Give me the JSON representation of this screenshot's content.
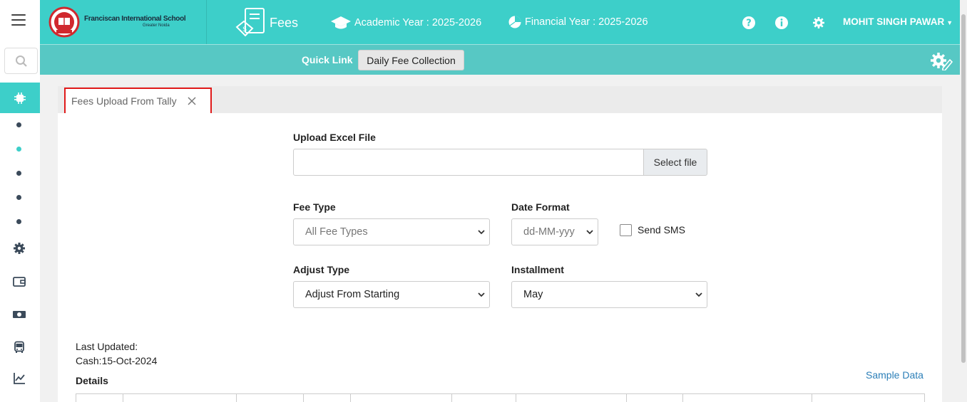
{
  "school": {
    "name": "Franciscan International School",
    "subtitle": "Greater Noida"
  },
  "module": {
    "title": "Fees"
  },
  "topbar": {
    "academic_year": "Academic Year : 2025-2026",
    "financial_year": "Financial Year : 2025-2026",
    "user": "MOHIT SINGH PAWAR"
  },
  "quicklink": {
    "label": "Quick Link",
    "button": "Daily Fee Collection"
  },
  "tab": {
    "label": "Fees Upload From Tally"
  },
  "form": {
    "upload_label": "Upload Excel File",
    "select_file": "Select file",
    "fee_type_label": "Fee Type",
    "fee_type_value": "All Fee Types",
    "date_format_label": "Date Format",
    "date_format_value": "dd-MM-yyy",
    "send_sms_label": "Send SMS",
    "adjust_type_label": "Adjust Type",
    "adjust_type_value": "Adjust From Starting",
    "installment_label": "Installment",
    "installment_value": "May"
  },
  "info": {
    "last_updated": "Last Updated:",
    "cash": "Cash:15-Oct-2024",
    "details": "Details",
    "sample_data": "Sample Data"
  },
  "colors": {
    "accent": "#3dcfc9",
    "quickbar": "#57c8c4",
    "highlight": "#e01a1a"
  }
}
